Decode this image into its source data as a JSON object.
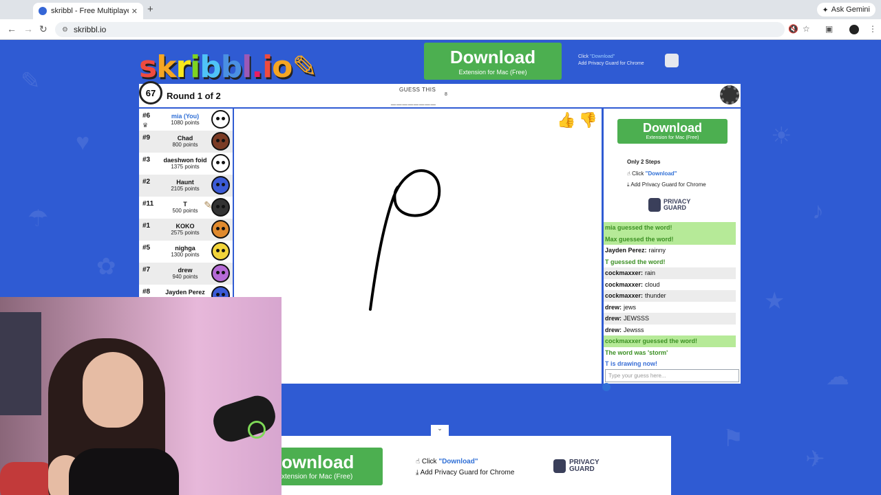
{
  "browser": {
    "tab_title": "skribbl - Free Multiplayer Dra",
    "tab_close": "✕",
    "new_tab": "+",
    "address": "skribbl.io",
    "ask_gemini": "Ask Gemini"
  },
  "logo": {
    "text": "skribbl.io"
  },
  "ads": {
    "download_label": "Download",
    "extension_label": "Extension for Mac (Free)",
    "click_prefix": "Click ",
    "click_download": "\"Download\"",
    "add_privacy_guard": "Add Privacy Guard for Chrome",
    "only_two_steps": "Only 2 Steps",
    "privacy": "PRIVACY",
    "guard": "GUARD",
    "bottom_download_label": "ownload",
    "bottom_extension_label": "xtension for Mac (Free)"
  },
  "game": {
    "timer": "67",
    "round": "Round 1 of 2",
    "guess_label": "GUESS THIS",
    "word_blanks": "________",
    "word_length": "8"
  },
  "players": [
    {
      "rank": "#6",
      "name": "mia (You)",
      "points": "1080 points",
      "me": true,
      "color": "#ffffff"
    },
    {
      "rank": "#9",
      "name": "Chad",
      "points": "800 points",
      "color": "#7a3b25"
    },
    {
      "rank": "#3",
      "name": "daeshwon foid",
      "points": "1375 points",
      "color": "#ffffff"
    },
    {
      "rank": "#2",
      "name": "Haunt",
      "points": "2105 points",
      "color": "#3b5bd6"
    },
    {
      "rank": "#11",
      "name": "T",
      "points": "500 points",
      "color": "#333333"
    },
    {
      "rank": "#1",
      "name": "KOKO",
      "points": "2575 points",
      "color": "#e08a2e"
    },
    {
      "rank": "#5",
      "name": "nighga",
      "points": "1300 points",
      "color": "#f2d43a"
    },
    {
      "rank": "#7",
      "name": "drew",
      "points": "940 points",
      "color": "#b56ad6"
    },
    {
      "rank": "#8",
      "name": "Jayden Perez",
      "points": "",
      "color": "#3b5bd6"
    }
  ],
  "chat": [
    {
      "type": "ok",
      "text": "mia guessed the word!"
    },
    {
      "type": "ok",
      "text": "Max guessed the word!"
    },
    {
      "type": "msg",
      "user": "Jayden Perez:",
      "text": "rainny"
    },
    {
      "type": "ok2",
      "text": "T guessed the word!"
    },
    {
      "type": "msg",
      "user": "cockmaxxer:",
      "text": "rain"
    },
    {
      "type": "msg",
      "user": "cockmaxxer:",
      "text": "cloud"
    },
    {
      "type": "msg",
      "user": "cockmaxxer:",
      "text": "thunder"
    },
    {
      "type": "msg",
      "user": "drew:",
      "text": "jews"
    },
    {
      "type": "msg",
      "user": "drew:",
      "text": "JEWSSS"
    },
    {
      "type": "msg",
      "user": "drew:",
      "text": "Jewsss"
    },
    {
      "type": "ok",
      "text": "cockmaxxer guessed the word!"
    },
    {
      "type": "ok2",
      "text": "The word was 'storm'"
    },
    {
      "type": "info",
      "text": "T is drawing now!"
    }
  ],
  "chat_input": {
    "placeholder": "Type your guess here..."
  },
  "colors": {
    "accent_green": "#4caf50",
    "bg_blue": "#2f5bd3",
    "guess_green": "#b6ea98"
  },
  "icons": [
    "back-icon",
    "forward-icon",
    "reload-icon",
    "settings-gear-icon",
    "thumbs-up-icon",
    "thumbs-down-icon",
    "alarm-clock-icon",
    "crown-icon",
    "pencil-icon",
    "chevron-down-icon"
  ]
}
